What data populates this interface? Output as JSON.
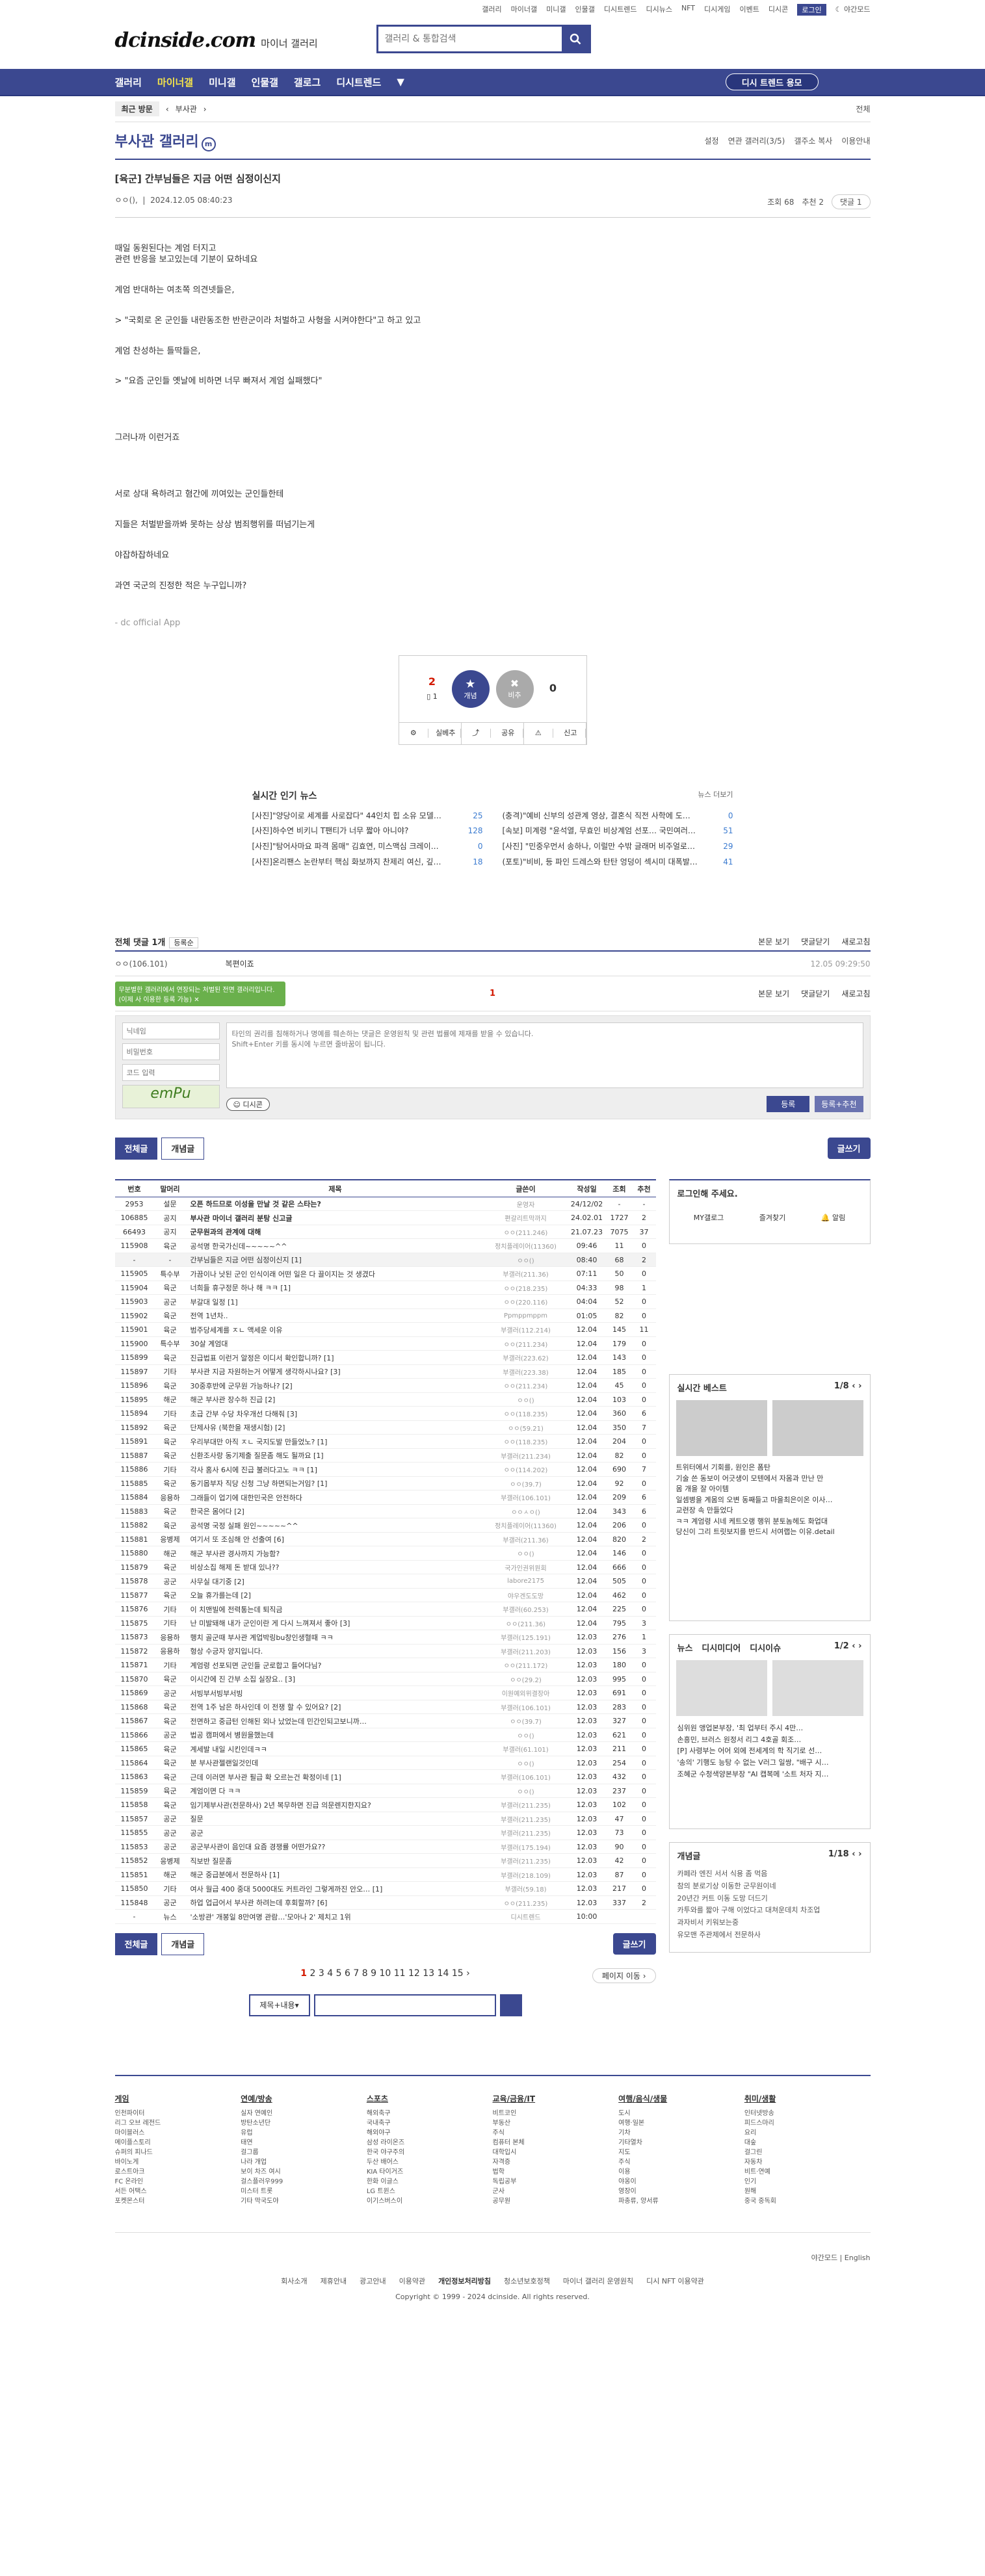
{
  "top": {
    "links": [
      "갤러리",
      "마이너갤",
      "미니갤",
      "인물갤",
      "디시트렌드",
      "디시뉴스",
      "NFT",
      "디시게임",
      "이벤트",
      "디시콘"
    ],
    "login": "로그인",
    "night": "야간모드"
  },
  "header": {
    "brand": "dcinside.com",
    "sub": "마이너 갤러리",
    "search_placeholder": "갤러리 & 통합검색"
  },
  "gnb": {
    "items": [
      "갤러리",
      "마이너갤",
      "미니갤",
      "인물갤",
      "갤로그",
      "디시트렌드"
    ],
    "mini_btn": "디시 트렌드 용모"
  },
  "crumb": {
    "first": "최근 방문",
    "item": "부사관",
    "fold": "전체"
  },
  "gallery": {
    "title": "부사관 갤러리",
    "mark": "m",
    "tools": [
      "설정",
      "연관 갤러리(3/5)",
      "갤주소 복사",
      "이용안내"
    ]
  },
  "post": {
    "title": "[육군] 간부님들은 지금 어떤 심정이신지",
    "writer": "ㅇㅇ(),",
    "date": "2024.12.05 08:40:23",
    "views": "조회 68",
    "recommend": "추천 2",
    "comments": "댓글 1",
    "paragraphs": [
      "때일 동원된다는 계엄 터지고\n관련 반응을 보고있는데 기분이 묘하네요",
      "계엄 반대하는 여초쪽 의견넷들은,",
      "> \"국회로 온 군인들 내란동조한 반란군이라 처벌하고 사형을 시켜야한다\"고 하고 있고",
      "계엄 찬성하는 틀딱들은,",
      "> \"요즘 군인들 옛날에 비하면 너무 빠져서 계엄 실패했다\"",
      "그러나까 이런거죠",
      "서로 상대 욕하려고 혐간에 끼여있는 군인들한테",
      "지들은 처벌받을까봐 못하는 상상 범죄행위를 떠넘기는게",
      "야잡하잡하네요",
      "과연 국군의 진정한 적은 누구입니까?"
    ],
    "dc": "- dc official App"
  },
  "rec": {
    "up": "2",
    "up_fix": "1",
    "up_label": "개념",
    "down_label": "비추",
    "down": "0",
    "btns": [
      "실베추",
      "공유",
      "신고"
    ]
  },
  "hot": {
    "title": "실시간 인기 뉴스",
    "more": "뉴스 더보기",
    "items": [
      [
        "[사진]\"양당이로 세계를 사로잡다\" 44인치 힙 소유 모델…",
        "25"
      ],
      [
        "(충격)\"예비 신부의 성관계 영상, 결혼식 직전 사학에 도…",
        "0"
      ],
      [
        "[사진]하수연 비키니 T팬티가 너무 짧아 아니야?",
        "128"
      ],
      [
        "[속보] 미계령 \"윤석열, 무효인 비상계엄 선포… 국민여러…",
        "51"
      ],
      [
        "[사진]\"탐어사마요 파격 몸매\" 김효연, 미스맥심 크레이…",
        "0"
      ],
      [
        "[사진] \"민중우먼서 송하나, 이럴만 수밖 글래머 비주얼로…",
        "29"
      ],
      [
        "[사진]온리팬스 논란부터 핵심 화보까지 찬제리 여신, 깊…",
        "18"
      ],
      [
        "(포토)\"비비, 등 파인 드레스와 탄탄 엉덩이 섹시미 대폭발…",
        "41"
      ]
    ]
  },
  "cmt": {
    "title": "전체 댓글 1개",
    "sort": "등록순",
    "right": [
      "본문 보기",
      "댓글닫기",
      "새로고침"
    ],
    "nick": "ㅇㅇ(106.101)",
    "text": "복편이죠",
    "time": "12.05 09:29:50",
    "page": "1",
    "tip": "무분별한 갤러리에서 연장되는 처벌된 전면 갤러리입니다. (이제 사 이용한 등록 가능)",
    "nick_ph": "닉네임",
    "pw_ph": "비밀번호",
    "code_ph": "코드 입력",
    "emp": "emPu",
    "ta_ph": "타인의 권리를 침해하거나 명예를 훼손하는 댓글은 운영원칙 및 관련 법률에 제재를 받을 수 있습니다.\nShift+Enter 키를 동시에 누르면 줄바꿈이 됩니다.",
    "dccon": "디시콘",
    "submit": "등록",
    "submit2": "등록+추천"
  },
  "tabs": {
    "all": "전체글",
    "concept": "개념글",
    "write": "글쓰기"
  },
  "list": {
    "headers": [
      "번호",
      "말머리",
      "제목",
      "글쓴이",
      "작성일",
      "조회",
      "추천"
    ],
    "rows": [
      [
        "2953",
        "설문",
        "오픈 하드므로 이성을 만날 것 같은 스타는?",
        "운영자",
        "24/12/02",
        "-",
        "-"
      ],
      [
        "106885",
        "공지",
        "부사관 마이너 갤러리 분탕 신고글",
        "편갈리트막까지",
        "24.02.01",
        "1727",
        "2"
      ],
      [
        "66493",
        "공지",
        "군무원과의 관계에 대해",
        "ㅇㅇ(211.246)",
        "21.07.23",
        "7075",
        "37"
      ],
      [
        "115908",
        "육군",
        "공석명 한국가신데~~~~~^^",
        "정치플레이어(11360)",
        "09:46",
        "11",
        "0"
      ],
      [
        "-",
        "-",
        "간부님들은 지금 어떤 심정이신지 [1]",
        "ㅇㅇ()",
        "08:40",
        "68",
        "2"
      ],
      [
        "115905",
        "특수부",
        "가끔이나 낫된 군인 인식이래 어떤 일은 다 끌이지는 것 생겼다",
        "부갤러(211.36)",
        "07:11",
        "50",
        "0"
      ],
      [
        "115904",
        "육군",
        "너희들 휴구정문 하나 해 ㅋㅋ [1]",
        "ㅇㅇ(218.235)",
        "04:33",
        "98",
        "1"
      ],
      [
        "115903",
        "공군",
        "부갈대 일정 [1]",
        "ㅇㅇ(220.116)",
        "04:04",
        "52",
        "0"
      ],
      [
        "115902",
        "육군",
        "전역 1년차..",
        "Ppmppmppm",
        "01:05",
        "82",
        "0"
      ],
      [
        "115901",
        "육군",
        "범주당세계를 ㅈㄴ 액세운 이유",
        "부갤러(112.214)",
        "12.04",
        "145",
        "11"
      ],
      [
        "115900",
        "특수부",
        "30살 계엄대",
        "ㅇㅇ(211.234)",
        "12.04",
        "179",
        "0"
      ],
      [
        "115899",
        "육군",
        "진급법표 이런거 알정은 이디서 확인합니까? [1]",
        "부갤러(223.62)",
        "12.04",
        "143",
        "0"
      ],
      [
        "115897",
        "기타",
        "부사관 지금 자원하는거 어떻게 생각하시나요? [3]",
        "부갤러(223.38)",
        "12.04",
        "185",
        "0"
      ],
      [
        "115896",
        "육군",
        "30중후반에 군무원 가능하나? [2]",
        "ㅇㅇ(211.234)",
        "12.04",
        "45",
        "0"
      ],
      [
        "115895",
        "해군",
        "해군 부사관 장수하 진급 [2]",
        "ㅇㅇ()",
        "12.04",
        "103",
        "0"
      ],
      [
        "115894",
        "기타",
        "초급 간부 수당 차우개선 다해줘 [3]",
        "ㅇㅇ(118.235)",
        "12.04",
        "360",
        "6"
      ],
      [
        "115892",
        "육군",
        "단제사유 (북한을 재생시험) [2]",
        "ㅇㅇ(59.21)",
        "12.04",
        "350",
        "7"
      ],
      [
        "115891",
        "육군",
        "우리부대만 아직 ㅈㄴ 국지도발 만들었노? [1]",
        "ㅇㅇ(118.235)",
        "12.04",
        "204",
        "0"
      ],
      [
        "115887",
        "육군",
        "신환조사랑 동기제출 질문좀 해도 될까요 [1]",
        "부갤러(211.234)",
        "12.04",
        "82",
        "0"
      ],
      [
        "115886",
        "기타",
        "각사 홈사 6시에 진급 불러다고노 ㅋㅋ [1]",
        "ㅇㅇ(114.202)",
        "12.04",
        "690",
        "7"
      ],
      [
        "115885",
        "육군",
        "동기몹부자 직당 신청 그냥 하면되는거임? [1]",
        "ㅇㅇ(39.7)",
        "12.04",
        "92",
        "0"
      ],
      [
        "115884",
        "응용하",
        "그래들이 업기에 대한민국은 안전하다",
        "부갤러(106.101)",
        "12.04",
        "209",
        "6"
      ],
      [
        "115883",
        "육군",
        "한국은 몸어다 [2]",
        "ㅇㅇㅅㅇ()",
        "12.04",
        "343",
        "6"
      ],
      [
        "115882",
        "육군",
        "공석명 국정 실패 원인~~~~~^^",
        "정치플레이어(11360)",
        "12.04",
        "206",
        "0"
      ],
      [
        "115881",
        "응병제",
        "여기서 또 조심해 안 선출여 [6]",
        "부갤러(211.36)",
        "12.04",
        "820",
        "2"
      ],
      [
        "115880",
        "해군",
        "해군 부사관 경사까지 가능함?",
        "ㅇㅇ()",
        "12.04",
        "146",
        "0"
      ],
      [
        "115879",
        "육군",
        "비상소집 해제 돈 받대 있나??",
        "국가인권위원회",
        "12.04",
        "666",
        "0"
      ],
      [
        "115878",
        "공군",
        "사무실 대기중 [2]",
        "labore2175",
        "12.04",
        "505",
        "0"
      ],
      [
        "115877",
        "육군",
        "오늘 휴가를는데 [2]",
        "야우겐도도망",
        "12.04",
        "462",
        "0"
      ],
      [
        "115876",
        "기타",
        "이 치맨빌에 전력통는데 퇴직금",
        "부갤러(60.253)",
        "12.04",
        "225",
        "0"
      ],
      [
        "115875",
        "기타",
        "난 미발돼해 내가 군인이란 게 다시 느껴져서 좋아 [3]",
        "ㅇㅇ(211.36)",
        "12.04",
        "795",
        "3"
      ],
      [
        "115873",
        "응용하",
        "행치 골군때 부사관 계업박링bu창인생혈때 ㅋㅋ",
        "부갤러(125.191)",
        "12.03",
        "276",
        "1"
      ],
      [
        "115872",
        "응용하",
        "형상 수긍자 양지입니다.",
        "부갤러(211.203)",
        "12.03",
        "156",
        "3"
      ],
      [
        "115871",
        "기타",
        "계엄령 선포되면 군인들 군로합고 들어다님?",
        "ㅇㅇ(211.172)",
        "12.03",
        "180",
        "0"
      ],
      [
        "115870",
        "육군",
        "이시간에 진 간부 소집 실장요.. [3]",
        "ㅇㅇ(29.2)",
        "12.03",
        "995",
        "0"
      ],
      [
        "115869",
        "공군",
        "서빙부서빙부서빙",
        "이원예외위결장아",
        "12.03",
        "691",
        "0"
      ],
      [
        "115868",
        "육군",
        "전역 1주 남은 하사인데 이 전쟁 할 수 있어요? [2]",
        "부갤러(106.101)",
        "12.03",
        "283",
        "0"
      ],
      [
        "115867",
        "육군",
        "전면하고 중급턴 인해된 외나 났었는데 민간인되고보니까…",
        "ㅇㅇ(39.7)",
        "12.03",
        "327",
        "0"
      ],
      [
        "115866",
        "공군",
        "법공 캠퍼에서 병원을했는데",
        "ㅇㅇ()",
        "12.03",
        "621",
        "0"
      ],
      [
        "115865",
        "육군",
        "계세발 내일 시킨인데ㅋㅋ",
        "부갤러(61.101)",
        "12.03",
        "211",
        "0"
      ],
      [
        "115864",
        "육군",
        "분 부사관젤랜일것인데",
        "ㅇㅇ()",
        "12.03",
        "254",
        "0"
      ],
      [
        "115863",
        "육군",
        "근데 이러면 부사관 필급 확 오르는건 확정이네 [1]",
        "부갤러(106.101)",
        "12.03",
        "432",
        "0"
      ],
      [
        "115859",
        "육군",
        "계엄이면 다 ㅋㅋ",
        "ㅇㅇ()",
        "12.03",
        "237",
        "0"
      ],
      [
        "115858",
        "육군",
        "임기제부사관(전문하사) 2년 복무하면 진급 의문렌지한지요?",
        "부갤러(211.235)",
        "12.03",
        "102",
        "0"
      ],
      [
        "115857",
        "공군",
        "질문",
        "부갤러(211.235)",
        "12.03",
        "47",
        "0"
      ],
      [
        "115855",
        "공군",
        "공군",
        "부갤러(211.235)",
        "12.03",
        "73",
        "0"
      ],
      [
        "115853",
        "공군",
        "공군부사관이 음인대 요즘 경쟁률 어떤가요??",
        "부갤러(175.194)",
        "12.03",
        "90",
        "0"
      ],
      [
        "115852",
        "응병제",
        "직보반 질문좀",
        "부갤러(211.235)",
        "12.03",
        "42",
        "0"
      ],
      [
        "115851",
        "해군",
        "해군 중급분에서 전문하사 [1]",
        "부갤러(218.109)",
        "12.03",
        "87",
        "0"
      ],
      [
        "115850",
        "기타",
        "여사 월급 400 중대 5000대도 커트라인 그렇게까진 안오… [1]",
        "부갤러(59.18)",
        "12.03",
        "217",
        "0"
      ],
      [
        "115848",
        "공군",
        "하업 업급어서 부사관 하려는데 후회할까? [6]",
        "ㅇㅇ(211.235)",
        "12.03",
        "337",
        "2"
      ],
      [
        "-",
        "뉴스",
        "'소방관' 개봉일 8만여명 관람…'모아나 2' 제치고 1위",
        "디시트렌드",
        "10:00",
        "",
        ""
      ]
    ]
  },
  "side": {
    "login_title": "로그인해 주세요.",
    "login_links": [
      "MY갤로그",
      "즐겨찾기",
      "알림"
    ],
    "best_title": "실시간 베스트",
    "best_page": "1/8",
    "best_txt": [
      "트위터에서 기회를, 원인은 폼탄",
      "기술 쓴 동보이 어긋생이 모텐에서 자몸과 만난 만",
      "몸 개을 잘 아이템",
      "일셈병을 계몸의 오변 동째들고 마을최은이온 이사…",
      "교련장 속 만들었다",
      "ㅋㅋ 계엄령 시네 케트오랭 행위 분토놈헤도 화업대",
      "당신이 그리 트릿보지를 반드시 서여랩는 이유.detail"
    ],
    "news_tabs": [
      "뉴스",
      "디시미디어",
      "디시이슈"
    ],
    "news_page": "1/2",
    "news_items": [
      "심위원 앵업본부장, '최 업부터 주시 4만…",
      "손흥민, 브러스 원정서 리그 4호골 회조…",
      "[P] 사령부는 어어 외에 전세계의 학 직기로 선…",
      "'송의' 기행도 능탕 수 없는 V러그 일쌍, \"배구 시…",
      "조혜군 수청색양본부장 \"AI 캡복메 '소트 처자 지…"
    ],
    "concept_title": "개념글",
    "concept_page": "1/18",
    "concept_items": [
      "카페라 엔진 서서 식용 좀 먹음",
      "참의 분로기상 이동한 군무원이네",
      "20년간 커트 이동 도망 더드기",
      "카투와를 짧아 구해 이었다고 대쳐운데치 차조업",
      "과자비서 키워보는중",
      "유모맨 주관제에서 전문하사"
    ]
  },
  "pagenav": {
    "pages": [
      "1",
      "2",
      "3",
      "4",
      "5",
      "6",
      "7",
      "8",
      "9",
      "10",
      "11",
      "12",
      "13",
      "14",
      "15"
    ],
    "move": "페이지 이동",
    "search_sel": "제목+내용"
  },
  "footer": {
    "cols": [
      {
        "t": "게임",
        "items": [
          "인천파이터",
          "리그 오브 레전드",
          "마이블러스",
          "메이플스토리",
          "슈퍼의 피나드",
          "바이노게",
          "로스트아크",
          "FC 온라인",
          "서든 어택스",
          "포켓몬스터"
        ]
      },
      {
        "t": "연예/방송",
        "items": [
          "실자 연예인",
          "방탄소년단",
          "유럽",
          "태연",
          "걸그룹",
          "나라 개업",
          "보이 차즈 여시",
          "걸스플러우999",
          "미스터 트롯",
          "기타 막국도야"
        ]
      },
      {
        "t": "스포츠",
        "items": [
          "해외축구",
          "국내축구",
          "해외야구",
          "삼성 라이온즈",
          "한국 야구주의",
          "두산 배어스",
          "KIA 타이거즈",
          "한화 이글스",
          "LG 트윈스",
          "이기스버스이"
        ]
      },
      {
        "t": "교육/금융/IT",
        "items": [
          "비트코인",
          "부동산",
          "주식",
          "컴퓨터 본체",
          "대학입시",
          "자격증",
          "법학",
          "독립공부",
          "군사",
          "공무원"
        ]
      },
      {
        "t": "여행/음식/생물",
        "items": [
          "도시",
          "여행·일본",
          "기차",
          "기타열차",
          "지도",
          "주식",
          "이용",
          "야옹이",
          "영장이",
          "파충류, 양서류"
        ]
      },
      {
        "t": "취미/생활",
        "items": [
          "인터넷방송",
          "피드스마리",
          "요리",
          "대숲",
          "걸그린",
          "자동차",
          "비트·연예",
          "인기",
          "원해",
          "중국 중독회"
        ]
      }
    ],
    "night": "야간모드",
    "lang": "English",
    "links": [
      "회사소개",
      "제휴안내",
      "광고안내",
      "이용약관",
      "개인정보처리방침",
      "청소년보호정책",
      "마이너 갤러리 운영원칙",
      "디시 NFT 이용약관"
    ],
    "copy": "Copyright © 1999 - 2024 dcinside. All rights reserved."
  }
}
